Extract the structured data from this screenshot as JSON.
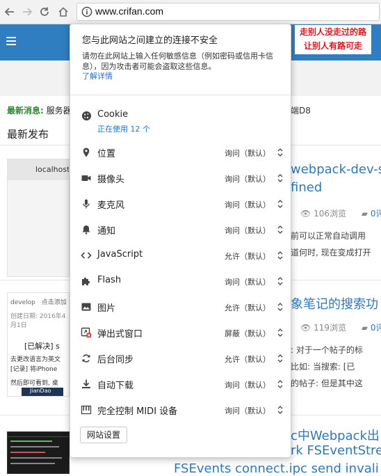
{
  "browser": {
    "url_text": "www.crifan.com"
  },
  "background_page": {
    "banner_line1": "走别人没走过的路",
    "banner_line2": "让别人有路可走",
    "news_label": "最新消息:",
    "news_text": "服务器",
    "news_right": "端D8",
    "section_title": "最新发布",
    "post1": {
      "thumb_text": "localhost",
      "title_line1": "webpack-dev-s",
      "title_line2": "fined",
      "views": "106浏览",
      "comments": "0评",
      "excerpt_line1": "前可以正常自动调用",
      "excerpt_line2": "道何时, 现在变成打开"
    },
    "post2": {
      "title": "象笔记的搜索功",
      "views": "119浏览",
      "comments": "0评",
      "excerpt_line1": ": 对于一个帖子的标",
      "excerpt_line2": "比如: 当搜索: [已",
      "excerpt_line3": "的帖子: 但是其中这",
      "thumb_header1": "develop",
      "thumb_header2": "点击添加",
      "thumb_date": "创建日期: 2016年4月1日",
      "thumb_title": "[已解决] s",
      "thumb_line1": "去更改语言为英文",
      "thumb_line2": "[记录] 将iPhone",
      "thumb_line3": "然后即可看到, 桌",
      "thumb_bottom": "JianDao"
    },
    "post3": {
      "title_line1": "c中Webpack出",
      "title_line2": "rk FSEventStre",
      "title_line3": "FSEvents connect.ipc send invali"
    }
  },
  "popup": {
    "title": "您与此网站之间建立的连接不安全",
    "description": "请勿在此网站上输入任何敏感信息（例如密码或信用卡信息），因为攻击者可能会盗取这些信息。",
    "learn_more": "了解详情",
    "cookie_label": "Cookie",
    "cookie_usage": "正在使用 12 个",
    "permissions": [
      {
        "label": "位置",
        "value": "询问（默认）",
        "icon": "location-pin-icon"
      },
      {
        "label": "摄像头",
        "value": "询问（默认）",
        "icon": "camera-icon"
      },
      {
        "label": "麦克风",
        "value": "询问（默认）",
        "icon": "microphone-icon"
      },
      {
        "label": "通知",
        "value": "询问（默认）",
        "icon": "bell-icon"
      },
      {
        "label": "JavaScript",
        "value": "允许（默认）",
        "icon": "code-icon"
      },
      {
        "label": "Flash",
        "value": "询问（默认）",
        "icon": "puzzle-icon"
      },
      {
        "label": "图片",
        "value": "允许（默认）",
        "icon": "image-icon"
      },
      {
        "label": "弹出式窗口",
        "value": "屏蔽（默认）",
        "icon": "popup-blocked-icon"
      },
      {
        "label": "后台同步",
        "value": "允许（默认）",
        "icon": "sync-icon"
      },
      {
        "label": "自动下载",
        "value": "询问（默认）",
        "icon": "download-icon"
      },
      {
        "label": "完全控制 MIDI 设备",
        "value": "询问（默认）",
        "icon": "midi-icon"
      }
    ],
    "site_settings_button": "网站设置"
  },
  "colors": {
    "link_blue": "#1a73e8",
    "header_blue": "#2f7ec2",
    "banner_red": "#e0161e"
  }
}
